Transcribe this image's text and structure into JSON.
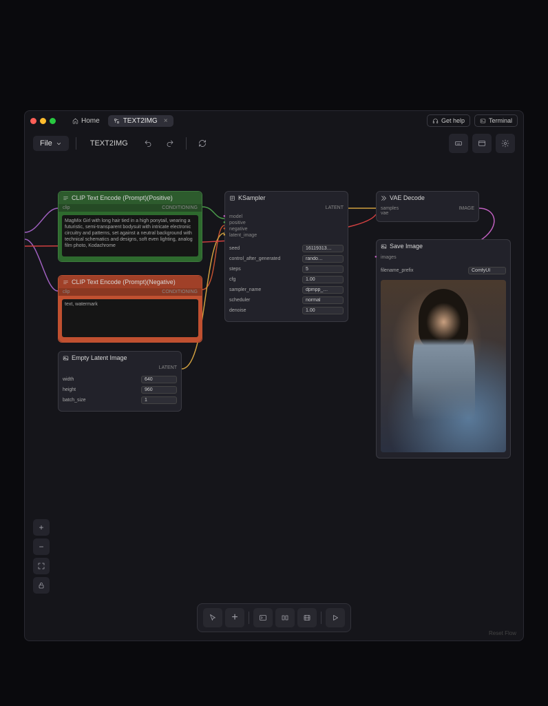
{
  "titlebar": {
    "home_label": "Home",
    "active_tab": "TEXT2IMG",
    "get_help": "Get help",
    "terminal": "Terminal"
  },
  "toolbar": {
    "file_label": "File",
    "workflow_name": "TEXT2IMG"
  },
  "nodes": {
    "clip_positive": {
      "title": "CLIP Text Encode (Prompt)(Positive)",
      "input_label": "clip",
      "output_label": "CONDITIONING",
      "text": "MagMix Girl with long hair tied in a high ponytail, wearing a futuristic, semi-transparent bodysuit with intricate electronic circuitry and patterns, set against a neutral background with technical schematics and designs, soft even lighting, analog film photo, Kodachrome"
    },
    "clip_negative": {
      "title": "CLIP Text Encode (Prompt)(Negative)",
      "input_label": "clip",
      "output_label": "CONDITIONING",
      "text": "text, watermark"
    },
    "latent": {
      "title": "Empty Latent Image",
      "output_label": "LATENT",
      "width_label": "width",
      "width_value": "640",
      "height_label": "height",
      "height_value": "960",
      "batch_label": "batch_size",
      "batch_value": "1"
    },
    "ksampler": {
      "title": "KSampler",
      "output_label": "LATENT",
      "inputs": {
        "model": "model",
        "positive": "positive",
        "negative": "negative",
        "latent_image": "latent_image"
      },
      "params": {
        "seed_label": "seed",
        "seed_value": "16119313…",
        "control_label": "control_after_generated",
        "control_value": "rando…",
        "steps_label": "steps",
        "steps_value": "5",
        "cfg_label": "cfg",
        "cfg_value": "1.00",
        "sampler_label": "sampler_name",
        "sampler_value": "dpmpp_…",
        "scheduler_label": "scheduler",
        "scheduler_value": "normal",
        "denoise_label": "denoise",
        "denoise_value": "1.00"
      }
    },
    "vae": {
      "title": "VAE Decode",
      "in_samples": "samples",
      "in_vae": "vae",
      "out_image": "IMAGE"
    },
    "save": {
      "title": "Save Image",
      "in_images": "images",
      "prefix_label": "filename_prefix",
      "prefix_value": "ComfyUI"
    }
  },
  "footer": {
    "reset_flow": "Reset Flow"
  }
}
